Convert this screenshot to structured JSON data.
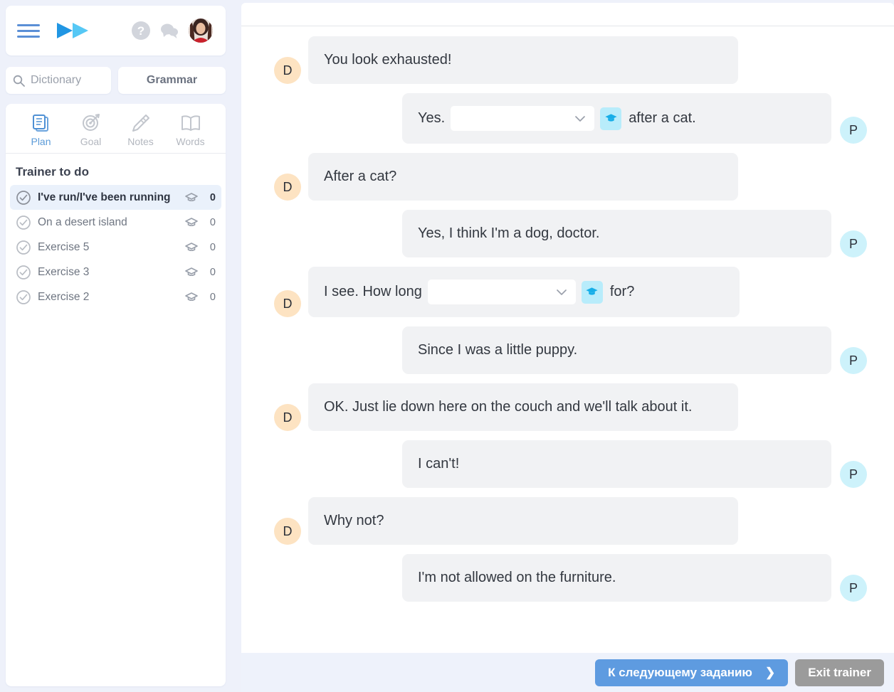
{
  "app": {
    "brand_color": "#2aa8e8",
    "accent_blue": "#5e9be0"
  },
  "topbar": {
    "menu_label": "menu",
    "logo_label": "fast-forward-logo",
    "help_label": "?",
    "chat_label": "messages",
    "avatar_label": "user"
  },
  "search": {
    "placeholder": "Dictionary",
    "grammar_label": "Grammar"
  },
  "tabs": [
    {
      "label": "Plan",
      "icon": "documents-icon",
      "active": true
    },
    {
      "label": "Goal",
      "icon": "target-icon",
      "active": false
    },
    {
      "label": "Notes",
      "icon": "pencil-icon",
      "active": false
    },
    {
      "label": "Words",
      "icon": "book-icon",
      "active": false
    }
  ],
  "todo": {
    "title": "Trainer to do",
    "items": [
      {
        "label": "I've run/I've been running",
        "count": "0",
        "selected": true
      },
      {
        "label": "On a desert island",
        "count": "0",
        "selected": false
      },
      {
        "label": "Exercise 5",
        "count": "0",
        "selected": false
      },
      {
        "label": "Exercise 3",
        "count": "0",
        "selected": false
      },
      {
        "label": "Exercise 2",
        "count": "0",
        "selected": false
      }
    ]
  },
  "chat": {
    "doctor_initial": "D",
    "patient_initial": "P",
    "messages": [
      {
        "side": "left",
        "speaker": "D",
        "type": "text",
        "text": "You look exhausted!"
      },
      {
        "side": "right",
        "speaker": "P",
        "type": "gap",
        "pre": "Yes.",
        "value": "",
        "post": "after a cat."
      },
      {
        "side": "left",
        "speaker": "D",
        "type": "text",
        "text": "After a cat?"
      },
      {
        "side": "right",
        "speaker": "P",
        "type": "text",
        "text": "Yes, I think I'm a dog, doctor."
      },
      {
        "side": "left",
        "speaker": "D",
        "type": "gap",
        "pre": "I see. How long",
        "value": "",
        "post": "for?"
      },
      {
        "side": "right",
        "speaker": "P",
        "type": "text",
        "text": "Since I was a little puppy."
      },
      {
        "side": "left",
        "speaker": "D",
        "type": "text",
        "text": "OK. Just lie down here on the couch and we'll talk about it."
      },
      {
        "side": "right",
        "speaker": "P",
        "type": "text",
        "text": "I can't!"
      },
      {
        "side": "left",
        "speaker": "D",
        "type": "text",
        "text": "Why not?"
      },
      {
        "side": "right",
        "speaker": "P",
        "type": "text",
        "text": "I'm not allowed on the furniture."
      }
    ]
  },
  "footer": {
    "next_label": "К следующему заданию",
    "next_arrow": "❯",
    "exit_label": "Exit trainer"
  }
}
